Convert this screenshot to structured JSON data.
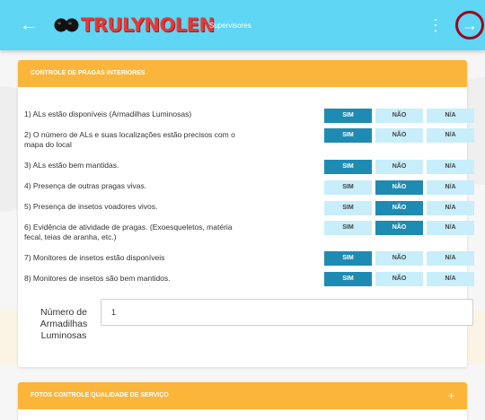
{
  "appbar": {
    "brand": "TRULYNOLEN",
    "subtitle": "Supervisores",
    "back_icon": "arrow-left-icon",
    "more_icon": "more-vertical-icon",
    "next_icon": "arrow-right-icon",
    "background_color": "#5ed6f4"
  },
  "section1": {
    "title": "CONTROLE DE PRAGAS INTERIORES",
    "header_color": "#fbb53a",
    "options": [
      "SIM",
      "NÃO",
      "N/A"
    ],
    "questions": [
      {
        "text": "1) ALs estão disponíveis (Armadilhas Luminosas)",
        "selected": "SIM"
      },
      {
        "text": "2) O número de ALs e suas localizações estão precisos com o mapa do local",
        "selected": "SIM"
      },
      {
        "text": "3) ALs estão bem mantidas.",
        "selected": "SIM"
      },
      {
        "text": "4) Presença de outras pragas vivas.",
        "selected": "NÃO"
      },
      {
        "text": "5) Presença de insetos voadores vivos.",
        "selected": "NÃO"
      },
      {
        "text": "6) Evidência de atividade de pragas. (Exoesqueletos, matéria fecal, teias de aranha, etc.)",
        "selected": "NÃO"
      },
      {
        "text": "7) Monitores de insetos estão disponíveis",
        "selected": "SIM"
      },
      {
        "text": "8) Monitores de insetos são bem mantidos.",
        "selected": "SIM"
      }
    ],
    "count_field": {
      "label": "Número de Armadilhas Luminosas",
      "value": "1"
    }
  },
  "section2": {
    "title": "FOTOS CONTROLE QUALIDADE DE SERVIÇO",
    "expand_label": "+"
  }
}
